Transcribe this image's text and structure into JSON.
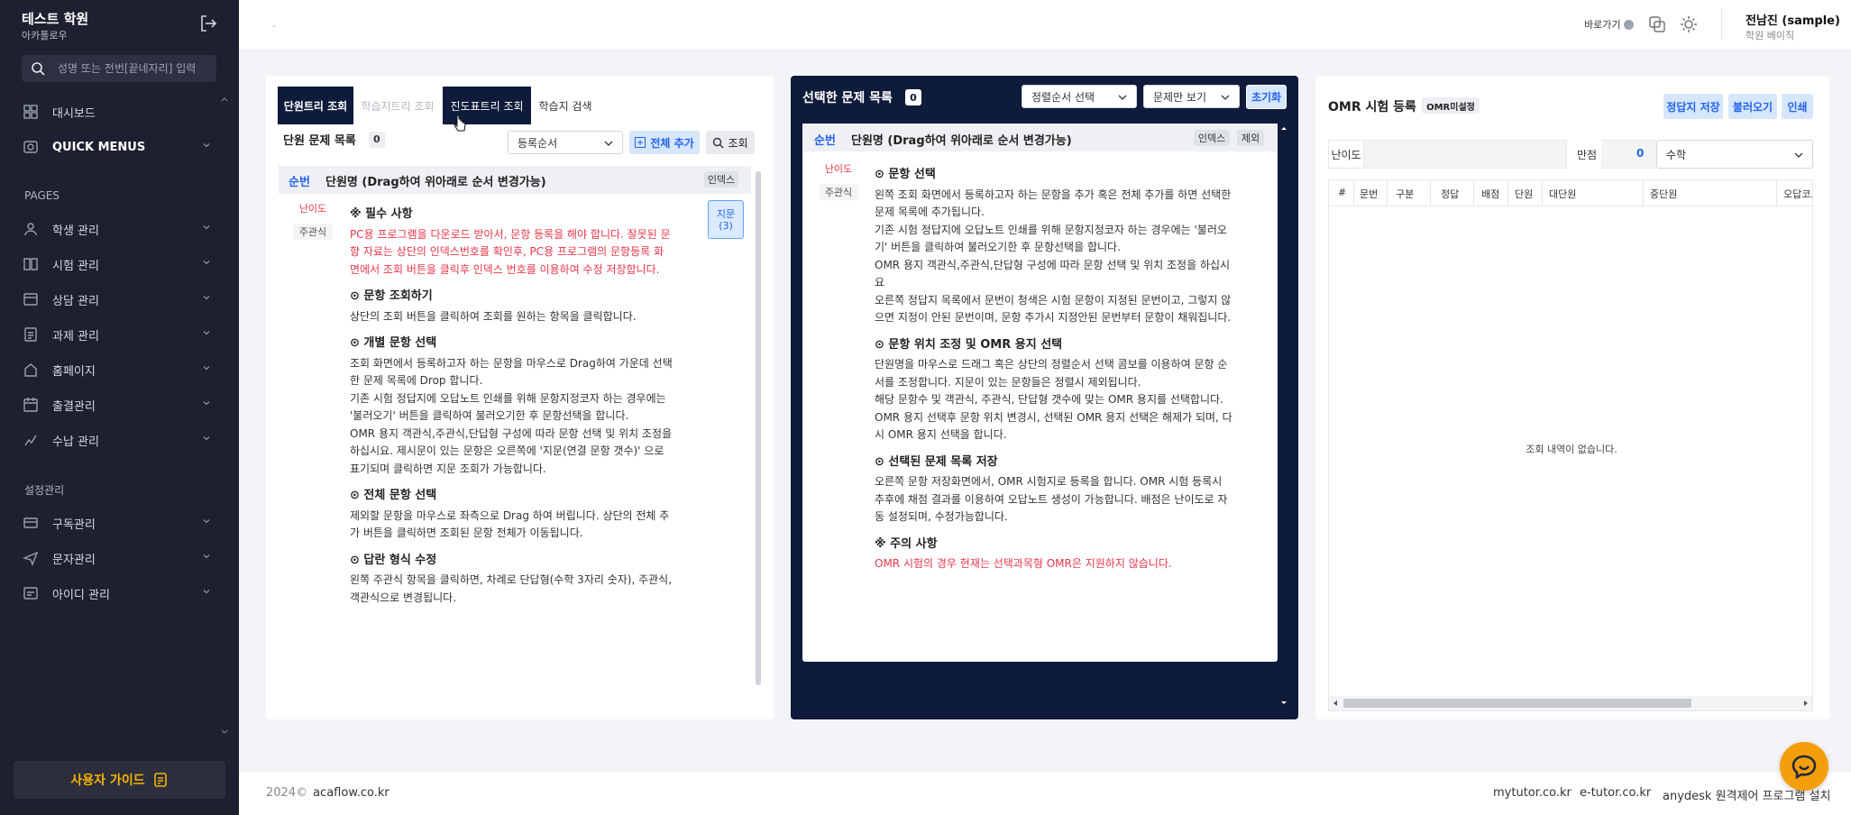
{
  "sidebar": {
    "brand_title": "테스트 학원",
    "brand_sub": "아카폴로우",
    "search_placeholder": "성명 또는 전번[끝네자리] 입력",
    "items": [
      {
        "label": "대시보드",
        "icon": "dashboard-icon"
      },
      {
        "label": "QUICK MENUS",
        "icon": "quick-menu-icon"
      }
    ],
    "section_pages": "PAGES",
    "pages": [
      {
        "label": "학생 관리",
        "icon": "student-icon"
      },
      {
        "label": "시험 관리",
        "icon": "exam-icon"
      },
      {
        "label": "상담 관리",
        "icon": "consult-icon"
      },
      {
        "label": "과제 관리",
        "icon": "task-icon"
      },
      {
        "label": "홈페이지",
        "icon": "home-icon"
      },
      {
        "label": "출결관리",
        "icon": "attendance-icon"
      },
      {
        "label": "수납 관리",
        "icon": "payment-icon"
      }
    ],
    "section_settings": "설정관리",
    "settings": [
      {
        "label": "구독관리",
        "icon": "subscription-icon"
      },
      {
        "label": "문자관리",
        "icon": "message-icon"
      },
      {
        "label": "아이디 관리",
        "icon": "id-icon"
      }
    ],
    "guide_button": "사용자 가이드"
  },
  "topbar": {
    "dash": "-",
    "shortcut": "바로가기",
    "user_name": "전남진 (sample)",
    "user_role": "학원 베이직"
  },
  "left_panel": {
    "tabs": [
      "단원트리 조회",
      "학습지트리 조회",
      "진도표트리 조회",
      "학습지 검색"
    ],
    "list_title": "단원 문제 목록",
    "count": "0",
    "sort_select": "등록순서",
    "add_all": "전체 추가",
    "query": "조회",
    "col_seq": "순번",
    "col_unit": "단원명 (Drag하여 위아래로 순서 변경가능)",
    "col_index": "인덱스",
    "tag_difficulty": "난이도",
    "tag_type": "주관식",
    "jimun": "지문",
    "jimun_count": "(3)",
    "h1": "※ 필수 사항",
    "p1": "PC용 프로그램을 다운로드 받아서, 문항 등록을 해야 합니다. 잘못된 문항 자료는 상단의 인덱스번호를 확인후, PC용 프로그램의 문항등록 화면에서 조회 버튼을 클릭후 인덱스 번호를 이용하여 수정 저장합니다.",
    "h2": "⊙ 문항 조회하기",
    "p2": "상단의 조회 버튼을 클릭하여 조회를 원하는 항목을 클릭합니다.",
    "h3": "⊙ 개별 문항 선택",
    "p3a": "조회 화면에서 등록하고자 하는 문항을 마우스로 Drag하여 가운데 선택한 문제 목록에 Drop 합니다.",
    "p3b": "기존 시험 정답지에 오답노트 인쇄를 위해 문항지정코자 하는 경우에는 '불러오기' 버튼을 클릭하여 불러오기한 후 문항선택을 합니다.",
    "p3c": "OMR 용지 객관식,주관식,단답형 구성에 따라 문항 선택 및 위치 조정을 하십시요. 제시문이 있는 문항은 오른쪽에 '지문(연결 문항 갯수)' 으로 표기되며 클릭하면 지문 조회가 가능합니다.",
    "h4": "⊙ 전체 문항 선택",
    "p4": "제외할 문항을 마우스로 좌측으로 Drag 하여 버립니다. 상단의 전체 추가 버튼을 클릭하면 조회된 문항 전체가 이동됩니다.",
    "h5": "⊙ 답란 형식 수정",
    "p5": "왼쪽 주관식 항목을 클릭하면, 차례로 단답형(수학 3자리 숫자), 주관식, 객관식으로 변경됩니다."
  },
  "middle_panel": {
    "title": "선택한 문제 목록",
    "count": "0",
    "sort_select": "정렬순서 선택",
    "view_select": "문제만 보기",
    "reset": "초기화",
    "col_seq": "순번",
    "col_unit": "단원명 (Drag하여 위아래로 순서 변경가능)",
    "col_index": "인덱스",
    "col_exclude": "제외",
    "tag_difficulty": "난이도",
    "tag_type": "주관식",
    "h1": "⊙ 문항 선택",
    "p1a": "왼쪽 조회 화면에서 등록하고자 하는 문항을 추가 혹은 전체 추가를 하면 선택한 문제 목록에 추가됩니다.",
    "p1b": "기존 시험 정답지에 오답노트 인쇄를 위해 문항지정코자 하는 경우에는 '불러오기' 버튼을 클릭하여 불러오기한 후 문항선택을 합니다.",
    "p1c": "OMR 용지 객관식,주관식,단답형 구성에 따라 문항 선택 및 위치 조정을 하십시요",
    "p1d": "오른쪽 정답지 목록에서 문번이 청색은 시험 문항이 지정된 문번이고, 그렇지 않으면 지정이 안된 문번이며, 문항 추가시 지정안된 문번부터 문항이 채워집니다.",
    "h2": "⊙ 문항 위치 조정 및 OMR 용지 선택",
    "p2a": "단원명을 마우스로 드래그 혹은 상단의 정렬순서 선택 콤보를 이용하여 문항 순서를 조정합니다. 지문이 있는 문항들은 정렬시 제외됩니다.",
    "p2b": "해당 문항수 및 객관식, 주관식, 단답형 갯수에 맞는 OMR 용지를 선택합니다.",
    "p2c": "OMR 용지 선택후 문항 위치 변경시, 선택된 OMR 용지 선택은 해제가 되며, 다시 OMR 용지 선택을 합니다.",
    "h3": "⊙ 선택된 문제 목록 저장",
    "p3": "오른쪽 문항 저장화면에서, OMR 시험지로 등록을 합니다. OMR 시험 등록시 추후에 채점 결과를 이용하여 오답노트 생성이 가능합니다. 배점은 난이도로 자동 설정되며, 수정가능합니다.",
    "h4": "※ 주의 사항",
    "p4": "OMR 시험의 경우 현재는 선택과목형 OMR은 지원하지 않습니다."
  },
  "right_panel": {
    "title": "OMR 시험 등록",
    "badge": "OMR미설정",
    "save_btn": "정답지 저장",
    "load_btn": "불러오기",
    "print_btn": "인쇄",
    "difficulty_label": "난이도",
    "score_label": "만점",
    "score_value": "0",
    "subject": "수학",
    "columns": [
      "#",
      "문번",
      "구분",
      "정답",
      "배점",
      "단원",
      "대단원",
      "중단원",
      "오답코드"
    ],
    "empty": "조회 내역이 없습니다."
  },
  "footer": {
    "copyright": "2024©",
    "site": "acaflow.co.kr",
    "links": [
      "mytutor.co.kr",
      "e-tutor.co.kr",
      "anydesk 원격제어 프로그램 설치"
    ]
  },
  "colors": {
    "sidebar": "#1e2030",
    "accent": "#2563eb",
    "navy": "#0f1b3a",
    "red": "#e6364b"
  }
}
